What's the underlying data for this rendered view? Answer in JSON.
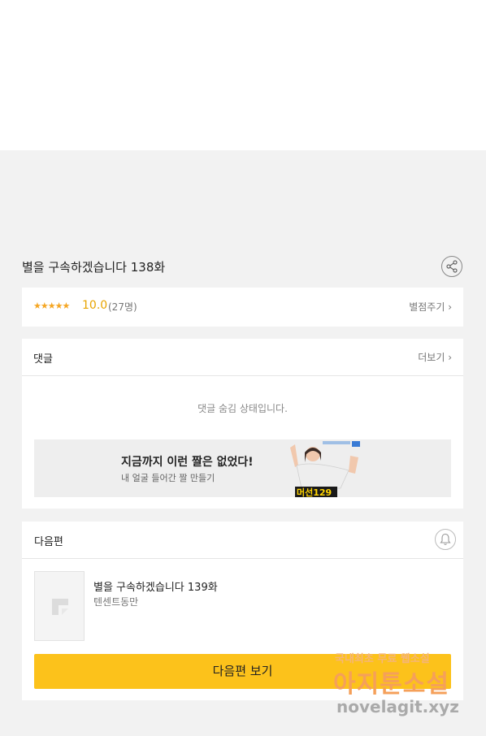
{
  "episode": {
    "title": "별을 구속하겠습니다 138화"
  },
  "rating": {
    "stars": "★★★★★",
    "score": "10.0",
    "count": "(27명)",
    "rate_link": "별점주기 ›"
  },
  "comments": {
    "title": "댓글",
    "more_link": "더보기 ›",
    "hidden_message": "댓글 숨김 상태입니다."
  },
  "ad": {
    "title": "지금까지 이런 짤은 없었다!",
    "subtitle": "내 얼굴 들어간 짤 만들기",
    "image_caption": "머선129"
  },
  "next_episode": {
    "header": "다음편",
    "title": "별을 구속하겠습니다 139화",
    "author": "텐센트동만",
    "button_label": "다음편 보기"
  },
  "watermark": {
    "line1": "국내최초 무료 웹소설",
    "line2": "아지툰소설",
    "line3": "novelagit.xyz"
  },
  "colors": {
    "background": "#f2f2f2",
    "star": "#f5a623",
    "button": "#fcc21b"
  },
  "icons": [
    "share-icon",
    "bell-icon",
    "image-placeholder-icon",
    "chevron-right-icon"
  ]
}
